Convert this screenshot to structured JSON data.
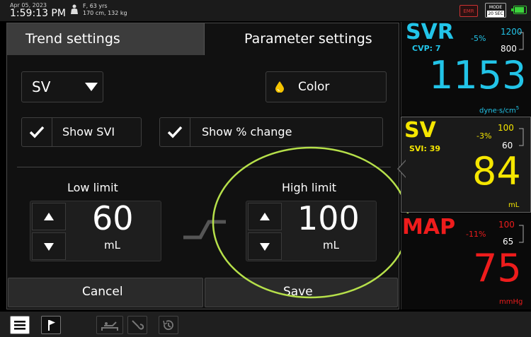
{
  "status_bar": {
    "date": "Apr 05, 2023",
    "time": "1:59:13 PM",
    "patient_line1": "F, 63 yrs",
    "patient_line2": "170 cm, 132 kg",
    "emr_label": "EMR",
    "mode_label": "MODE",
    "mode_value": "20 SEC",
    "battery_color": "#3cd43c"
  },
  "tabs": {
    "trend": "Trend settings",
    "parameter": "Parameter settings"
  },
  "settings": {
    "parameter_select": "SV",
    "color_button": "Color",
    "show_svi": "Show SVI",
    "show_pct_change": "Show % change",
    "low_limit_label": "Low limit",
    "low_limit_value": "60",
    "low_limit_unit": "mL",
    "high_limit_label": "High limit",
    "high_limit_value": "100",
    "high_limit_unit": "mL",
    "cancel": "Cancel",
    "save": "Save"
  },
  "tiles": [
    {
      "name": "SVR",
      "sub": "CVP: 7",
      "pct": "-5%",
      "upper": "1200",
      "lower": "800",
      "value": "1153",
      "unit": "dyne·s/cm",
      "unit_sup": "5",
      "color": "#22c4e8"
    },
    {
      "name": "SV",
      "sub": "SVI: 39",
      "pct": "-3%",
      "upper": "100",
      "lower": "60",
      "value": "84",
      "unit": "mL",
      "color": "#f5e600"
    },
    {
      "name": "MAP",
      "pct": "-11%",
      "upper": "100",
      "lower": "65",
      "value": "75",
      "unit": "mmHg",
      "color": "#ee1c1c"
    }
  ],
  "colors": {
    "drop_icon": "#f5c400",
    "annotation_circle": "#b6e04a"
  },
  "toolbar_icons": [
    "menu-icon",
    "flag-icon",
    "bed-icon",
    "probe-icon",
    "history-icon"
  ]
}
